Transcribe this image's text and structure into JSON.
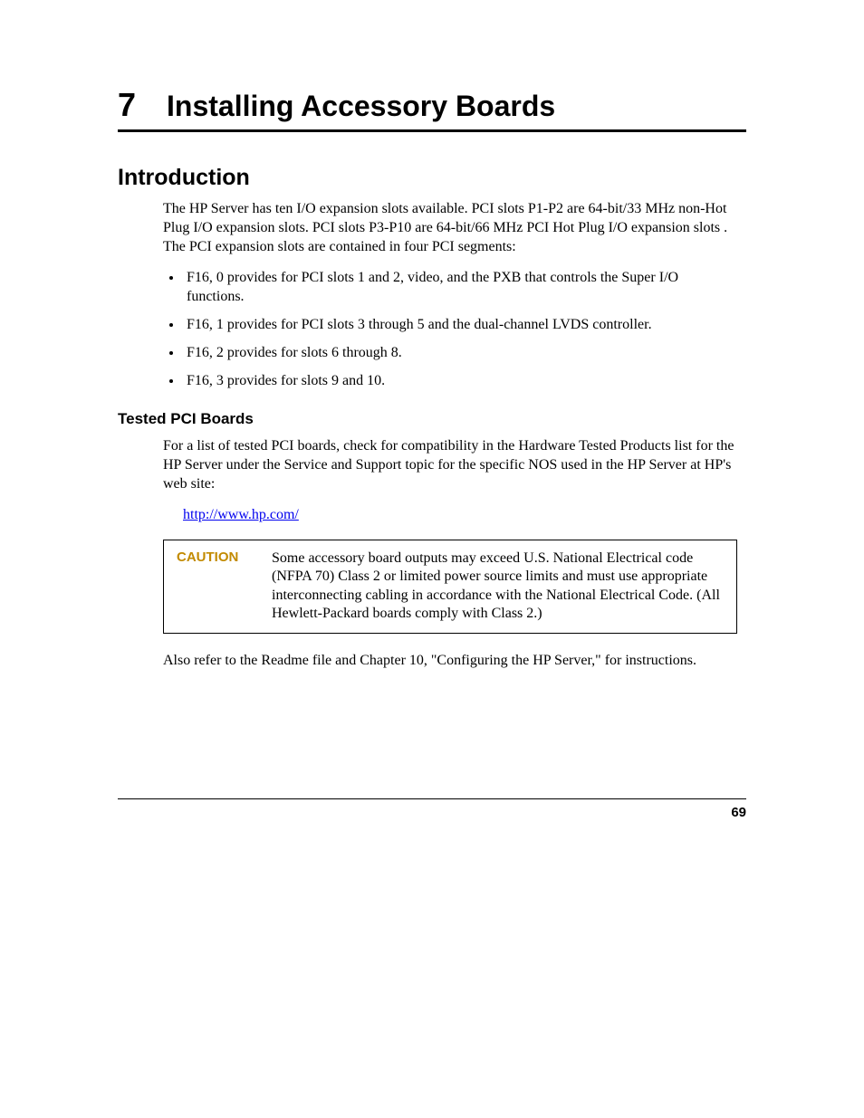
{
  "chapter": {
    "number": "7",
    "title": "Installing Accessory Boards"
  },
  "section1": {
    "heading": "Introduction",
    "para": "The HP Server has ten I/O expansion slots available.  PCI slots P1-P2 are 64-bit/33 MHz non-Hot Plug I/O expansion slots. PCI slots P3-P10 are 64-bit/66 MHz PCI Hot Plug I/O expansion slots . The PCI expansion slots are contained in four PCI segments:",
    "bullets": [
      "F16, 0 provides for PCI slots 1 and 2, video, and the PXB that controls the Super I/O functions.",
      "F16, 1 provides for PCI slots 3 through 5 and the dual-channel LVDS controller.",
      "F16, 2 provides for slots 6 through 8.",
      "F16, 3 provides for slots 9 and 10."
    ]
  },
  "section2": {
    "heading": "Tested PCI Boards",
    "para": "For a list of tested PCI boards, check for compatibility in the Hardware Tested Products list for the HP Server under the Service and Support topic for the specific NOS used in the HP Server at HP's web site:",
    "link": "http://www.hp.com/"
  },
  "caution": {
    "label": "CAUTION",
    "text": "Some accessory board outputs may exceed U.S. National Electrical code (NFPA 70) Class 2 or limited power source limits and must use appropriate interconnecting cabling in accordance with the National Electrical Code. (All Hewlett-Packard boards comply with Class 2.)"
  },
  "closing": "Also refer to the Readme file and Chapter 10, \"Configuring the HP Server,\" for instructions.",
  "pageNumber": "69"
}
